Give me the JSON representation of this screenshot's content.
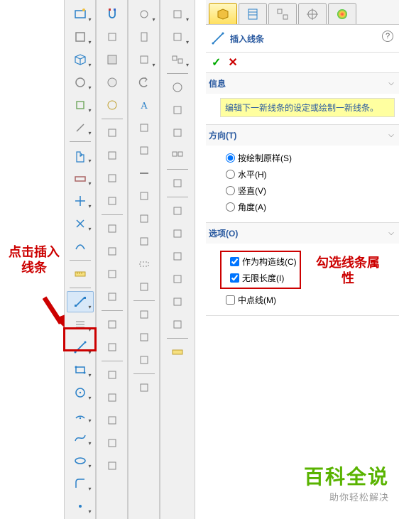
{
  "panel": {
    "title": "插入线条",
    "ok": "✓",
    "cancel": "✕",
    "help": "?"
  },
  "sections": {
    "info": {
      "title": "信息",
      "message": "编辑下一新线条的设定或绘制一新线条。"
    },
    "direction": {
      "title": "方向(T)",
      "options": {
        "as_sketched": "按绘制原样(S)",
        "horizontal": "水平(H)",
        "vertical": "竖直(V)",
        "angle": "角度(A)"
      }
    },
    "options": {
      "title": "选项(O)",
      "construction": "作为构造线(C)",
      "infinite": "无限长度(I)",
      "midpoint": "中点线(M)"
    }
  },
  "annotations": {
    "click_insert": "点击插入线条",
    "check_props": "勾选线条属性"
  },
  "watermark": {
    "big": "百科全说",
    "small": "助你轻松解决"
  }
}
